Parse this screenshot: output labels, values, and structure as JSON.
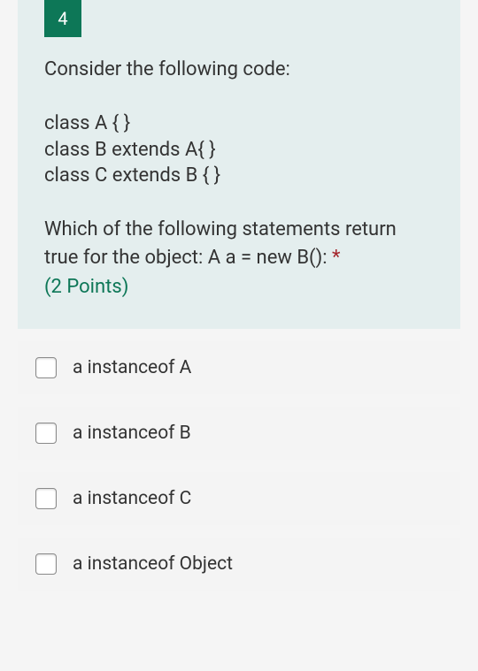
{
  "question": {
    "number": "4",
    "prompt": "Consider the following code:",
    "code_lines": [
      "class A {  }",
      "class B extends A{ }",
      "class C extends B { }"
    ],
    "follow_text": "Which of the following statements return true for the object: A a = new B(): ",
    "required_marker": "*",
    "points": "(2 Points)"
  },
  "options": [
    {
      "label": "a instanceof A"
    },
    {
      "label": "a instanceof B"
    },
    {
      "label": "a instanceof C"
    },
    {
      "label": "a instanceof Object"
    }
  ]
}
